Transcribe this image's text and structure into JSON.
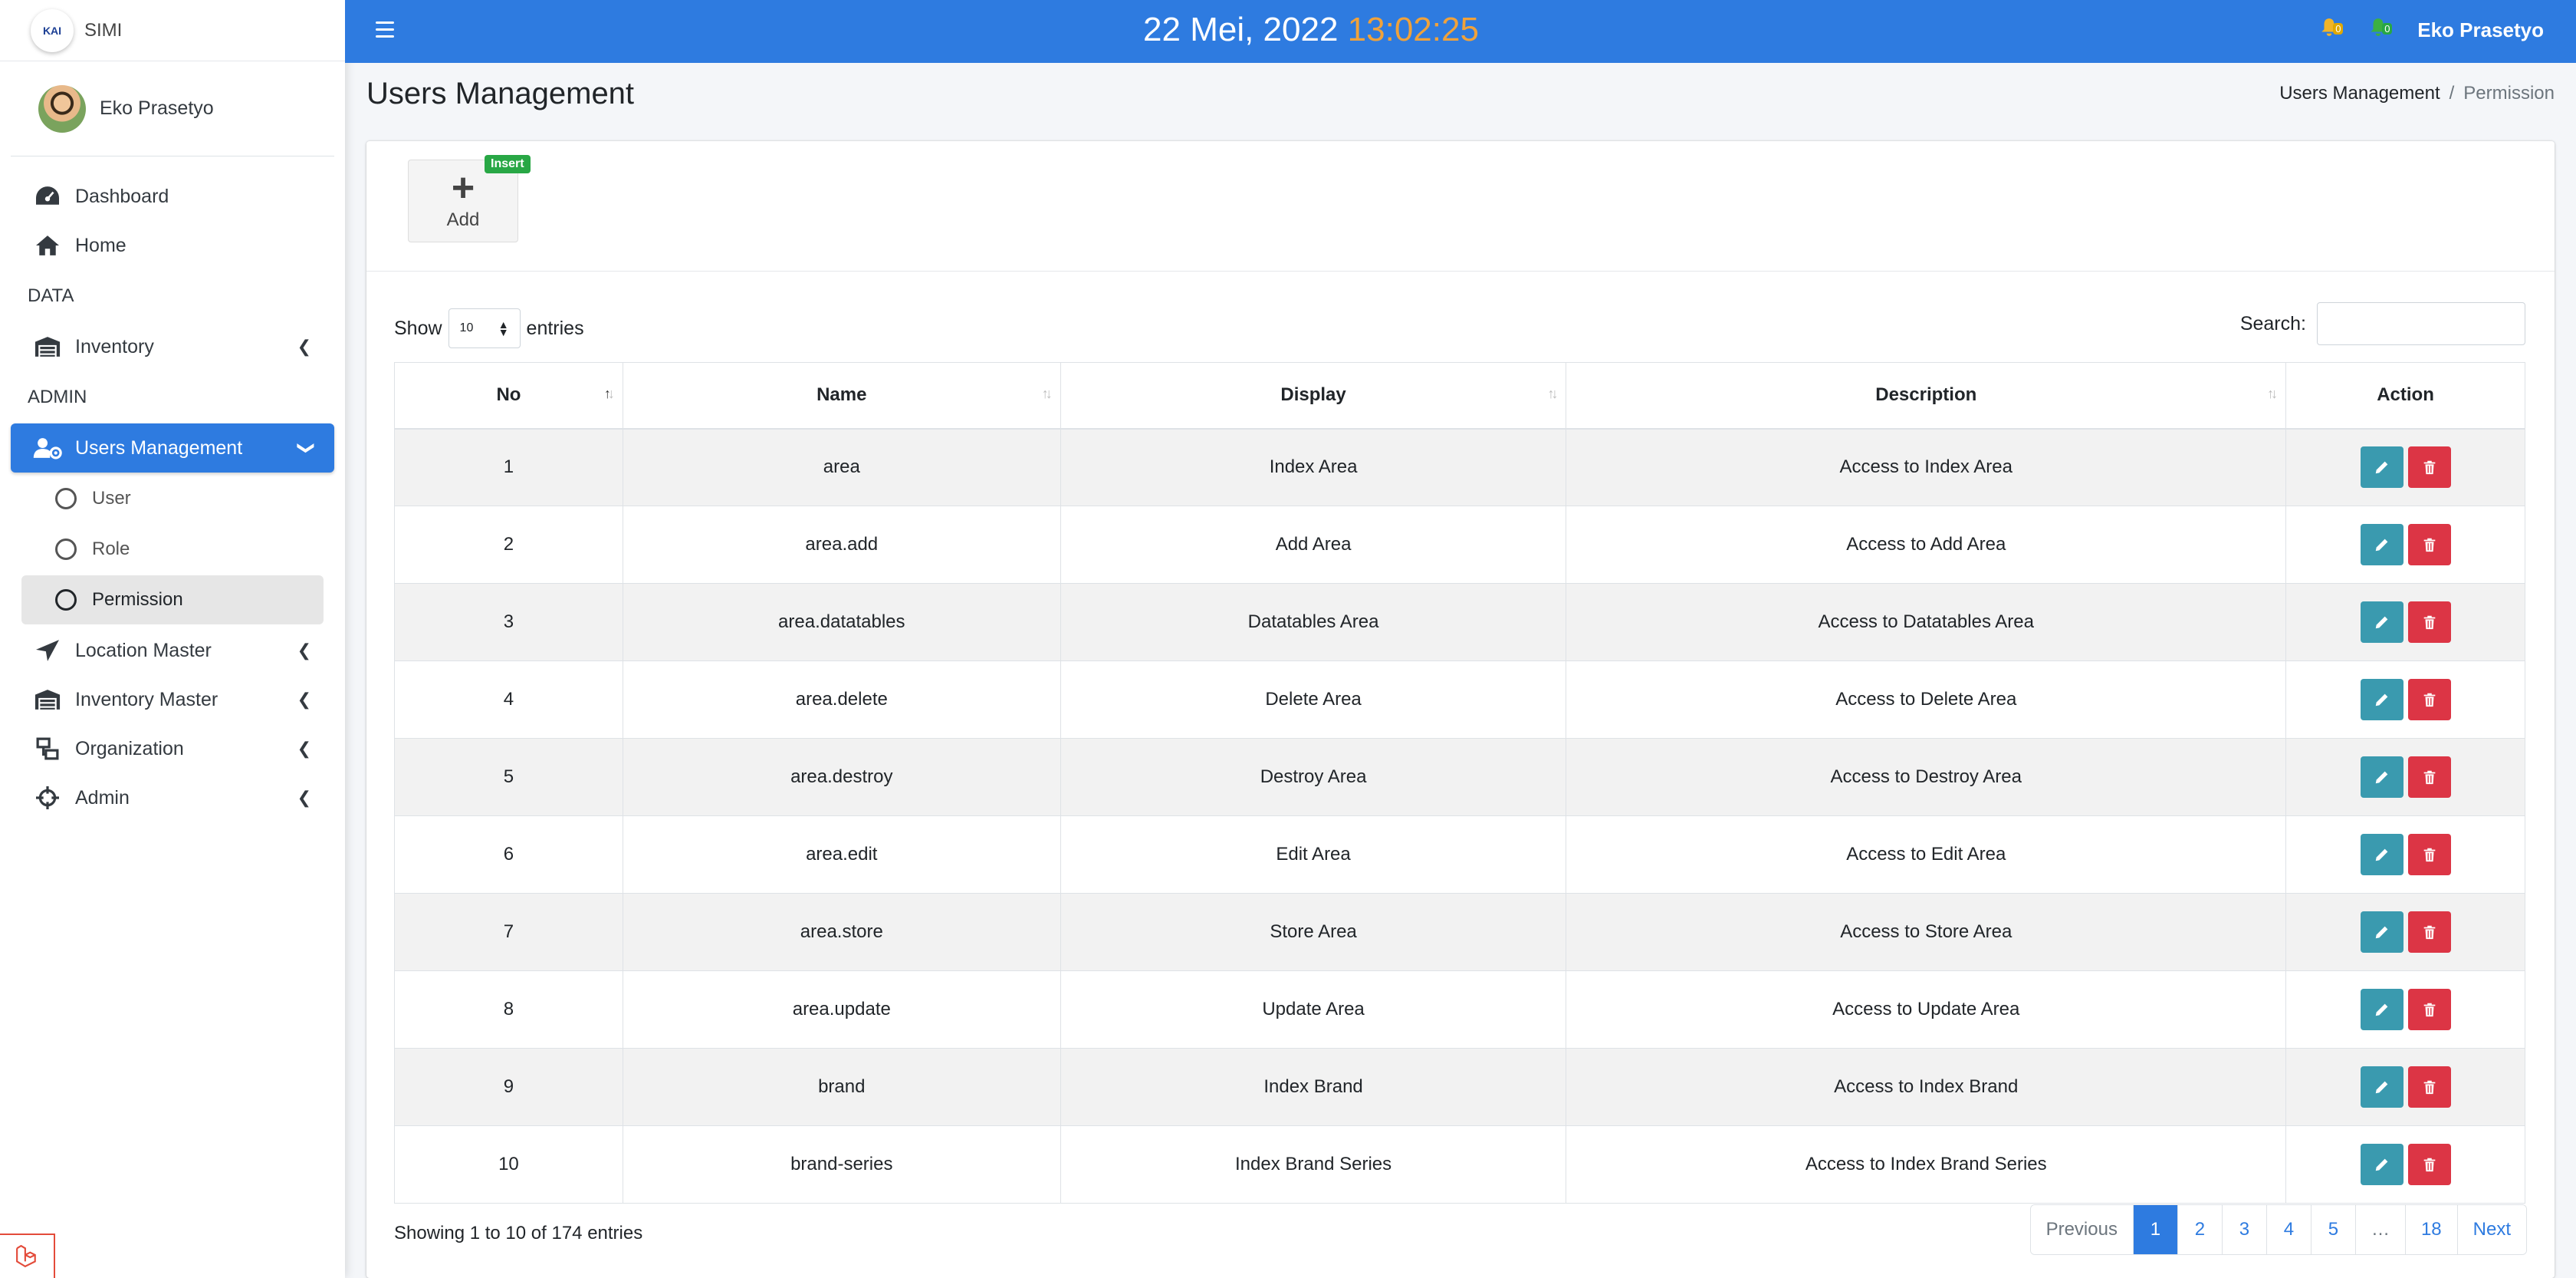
{
  "brand": {
    "logo_text": "KAI",
    "name": "SIMI"
  },
  "user": {
    "name": "Eko Prasetyo"
  },
  "sidebar": {
    "items": [
      {
        "label": "Dashboard",
        "icon": "tachometer-icon"
      },
      {
        "label": "Home",
        "icon": "home-icon"
      }
    ],
    "header_data": "DATA",
    "inventory": {
      "label": "Inventory",
      "icon": "warehouse-icon"
    },
    "header_admin": "ADMIN",
    "users_management": {
      "label": "Users Management",
      "icon": "users-cog-icon"
    },
    "sub": [
      {
        "label": "User"
      },
      {
        "label": "Role"
      },
      {
        "label": "Permission"
      }
    ],
    "more": [
      {
        "label": "Location Master",
        "icon": "location-arrow-icon"
      },
      {
        "label": "Inventory Master",
        "icon": "warehouse-icon"
      },
      {
        "label": "Organization",
        "icon": "sitemap-icon"
      },
      {
        "label": "Admin",
        "icon": "crosshairs-icon"
      }
    ]
  },
  "topbar": {
    "date": "22 Mei, 2022",
    "time": "13:02:25",
    "notif_yellow": "0",
    "notif_green": "0",
    "user": "Eko Prasetyo",
    "colors": {
      "primary": "#2e7be0",
      "time": "#f0a23b"
    }
  },
  "page": {
    "title": "Users Management",
    "breadcrumb": [
      "Users Management",
      "Permission"
    ]
  },
  "toolbar": {
    "add_label": "Add",
    "insert_badge": "Insert"
  },
  "table_controls": {
    "show": "Show",
    "entries_value": "10",
    "entries": "entries",
    "search_label": "Search:"
  },
  "table": {
    "columns": [
      "No",
      "Name",
      "Display",
      "Description",
      "Action"
    ],
    "rows": [
      {
        "no": "1",
        "name": "area",
        "display": "Index Area",
        "description": "Access to Index Area"
      },
      {
        "no": "2",
        "name": "area.add",
        "display": "Add Area",
        "description": "Access to Add Area"
      },
      {
        "no": "3",
        "name": "area.datatables",
        "display": "Datatables Area",
        "description": "Access to Datatables Area"
      },
      {
        "no": "4",
        "name": "area.delete",
        "display": "Delete Area",
        "description": "Access to Delete Area"
      },
      {
        "no": "5",
        "name": "area.destroy",
        "display": "Destroy Area",
        "description": "Access to Destroy Area"
      },
      {
        "no": "6",
        "name": "area.edit",
        "display": "Edit Area",
        "description": "Access to Edit Area"
      },
      {
        "no": "7",
        "name": "area.store",
        "display": "Store Area",
        "description": "Access to Store Area"
      },
      {
        "no": "8",
        "name": "area.update",
        "display": "Update Area",
        "description": "Access to Update Area"
      },
      {
        "no": "9",
        "name": "brand",
        "display": "Index Brand",
        "description": "Access to Index Brand"
      },
      {
        "no": "10",
        "name": "brand-series",
        "display": "Index Brand Series",
        "description": "Access to Index Brand Series"
      }
    ]
  },
  "footer": {
    "info": "Showing 1 to 10 of 174 entries",
    "pages": [
      "Previous",
      "1",
      "2",
      "3",
      "4",
      "5",
      "…",
      "18",
      "Next"
    ]
  }
}
